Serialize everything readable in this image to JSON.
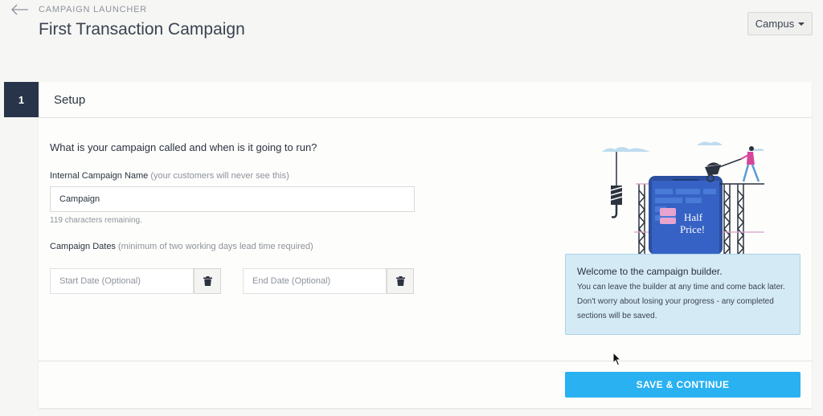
{
  "header": {
    "breadcrumb": "CAMPAIGN LAUNCHER",
    "title": "First Transaction Campaign",
    "campus_label": "Campus"
  },
  "step": {
    "number": "1",
    "title": "Setup"
  },
  "form": {
    "question": "What is your campaign called and when is it going to run?",
    "name_label": "Internal Campaign Name",
    "name_hint": "(your customers will never see this)",
    "name_value": "Campaign",
    "chars_remaining": "119 characters remaining.",
    "dates_label": "Campaign Dates",
    "dates_hint": "(minimum of two working days lead time required)",
    "start_placeholder": "Start Date (Optional)",
    "end_placeholder": "End Date (Optional)"
  },
  "illustration": {
    "sign_text_1": "Half",
    "sign_text_2": "Price!"
  },
  "welcome": {
    "title": "Welcome to the campaign builder.",
    "text": "You can leave the builder at any time and come back later. Don't worry about losing your progress - any completed sections will be saved."
  },
  "footer": {
    "save_label": "SAVE & CONTINUE"
  },
  "colors": {
    "step_badge": "#283449",
    "primary": "#29b1f1",
    "info_bg": "#d4eaf5"
  }
}
